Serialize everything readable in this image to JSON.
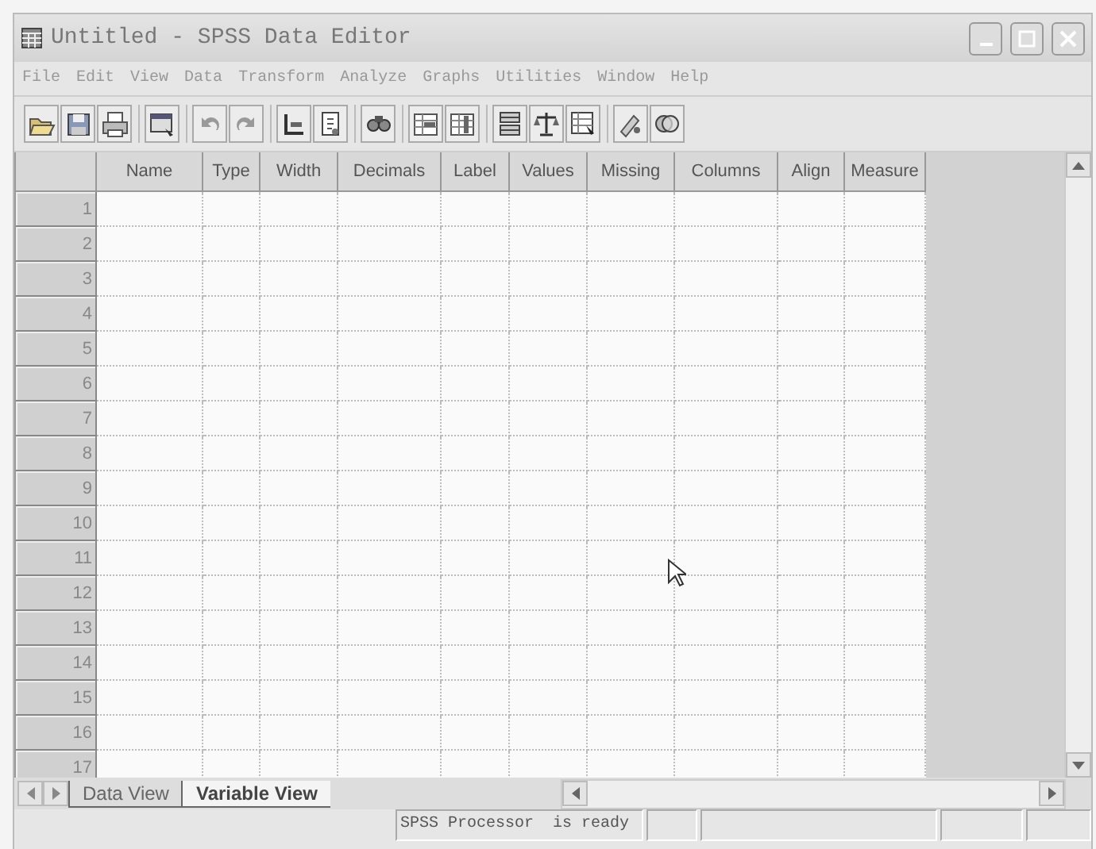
{
  "window": {
    "title": "Untitled - SPSS Data Editor"
  },
  "menu": [
    "File",
    "Edit",
    "View",
    "Data",
    "Transform",
    "Analyze",
    "Graphs",
    "Utilities",
    "Window",
    "Help"
  ],
  "grid": {
    "columns": [
      "Name",
      "Type",
      "Width",
      "Decimals",
      "Label",
      "Values",
      "Missing",
      "Columns",
      "Align",
      "Measure"
    ],
    "rows": [
      "1",
      "2",
      "3",
      "4",
      "5",
      "6",
      "7",
      "8",
      "9",
      "10",
      "11",
      "12",
      "13",
      "14",
      "15",
      "16",
      "17"
    ]
  },
  "tabs": [
    {
      "label": "Data View",
      "selected": false
    },
    {
      "label": "Variable View",
      "selected": true
    }
  ],
  "status_bar": {
    "message": "SPSS Processor  is ready"
  }
}
